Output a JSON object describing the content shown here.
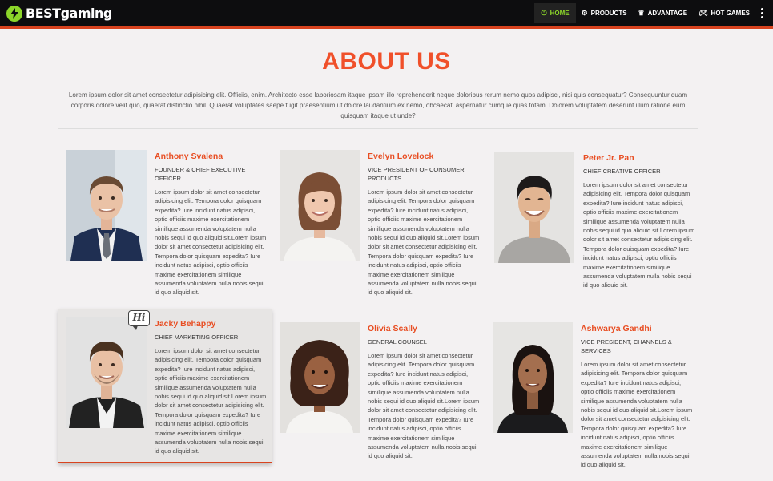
{
  "nav": {
    "brand_bold": "BEST",
    "brand_rest": "gaming",
    "items": [
      {
        "label": "HOME",
        "icon": "power-icon"
      },
      {
        "label": "PRODUCTS",
        "icon": "gear-icon"
      },
      {
        "label": "ADVANTAGE",
        "icon": "crown-icon"
      },
      {
        "label": "HOT GAMES",
        "icon": "gamepad-icon"
      }
    ],
    "accent": "#8cd62a"
  },
  "page": {
    "title": "ABOUT US",
    "intro": "Lorem ipsum dolor sit amet consectetur adipisicing elit. Officiis, enim. Architecto esse laboriosam itaque ipsam illo reprehenderit neque doloribus rerum nemo quos adipisci, nisi quis consequatur? Consequuntur quam corporis dolore velit quo, quaerat distinctio nihil. Quaerat voluptates saepe fugit praesentium ut dolore laudantium ex nemo, obcaecati aspernatur cumque quas totam. Dolorem voluptatem deserunt illum ratione eum quisquam itaque ut unde?",
    "title_color": "#f0502a"
  },
  "team": [
    {
      "name": "Anthony Svalena",
      "role": "FOUNDER & CHIEF EXECUTIVE OFFICER",
      "bio": "Lorem ipsum dolor sit amet consectetur adipisicing elit. Tempora dolor quisquam expedita? Iure incidunt natus adipisci, optio officiis maxime exercitationem similique assumenda voluptatem nulla nobis sequi id quo aliquid sit.Lorem ipsum dolor sit amet consectetur adipisicing elit. Tempora dolor quisquam expedita? Iure incidunt natus adipisci, optio officiis maxime exercitationem similique assumenda voluptatem nulla nobis sequi id quo aliquid sit."
    },
    {
      "name": "Evelyn Lovelock",
      "role": "VICE PRESIDENT OF CONSUMER PRODUCTS",
      "bio": "Lorem ipsum dolor sit amet consectetur adipisicing elit. Tempora dolor quisquam expedita? Iure incidunt natus adipisci, optio officiis maxime exercitationem similique assumenda voluptatem nulla nobis sequi id quo aliquid sit.Lorem ipsum dolor sit amet consectetur adipisicing elit. Tempora dolor quisquam expedita? Iure incidunt natus adipisci, optio officiis maxime exercitationem similique assumenda voluptatem nulla nobis sequi id quo aliquid sit."
    },
    {
      "name": "Peter Jr. Pan",
      "role": "CHIEF CREATIVE OFFICER",
      "bio": "Lorem ipsum dolor sit amet consectetur adipisicing elit. Tempora dolor quisquam expedita? Iure incidunt natus adipisci, optio officiis maxime exercitationem similique assumenda voluptatem nulla nobis sequi id quo aliquid sit.Lorem ipsum dolor sit amet consectetur adipisicing elit. Tempora dolor quisquam expedita? Iure incidunt natus adipisci, optio officiis maxime exercitationem similique assumenda voluptatem nulla nobis sequi id quo aliquid sit."
    },
    {
      "name": "Jacky Behappy",
      "role": "CHIEF MARKETING OFFICER",
      "bio": "Lorem ipsum dolor sit amet consectetur adipisicing elit. Tempora dolor quisquam expedita? Iure incidunt natus adipisci, optio officiis maxime exercitationem similique assumenda voluptatem nulla nobis sequi id quo aliquid sit.Lorem ipsum dolor sit amet consectetur adipisicing elit. Tempora dolor quisquam expedita? Iure incidunt natus adipisci, optio officiis maxime exercitationem similique assumenda voluptatem nulla nobis sequi id quo aliquid sit.",
      "badge": "Hi"
    },
    {
      "name": "Olivia Scally",
      "role": "GENERAL COUNSEL",
      "bio": "Lorem ipsum dolor sit amet consectetur adipisicing elit. Tempora dolor quisquam expedita? Iure incidunt natus adipisci, optio officiis maxime exercitationem similique assumenda voluptatem nulla nobis sequi id quo aliquid sit.Lorem ipsum dolor sit amet consectetur adipisicing elit. Tempora dolor quisquam expedita? Iure incidunt natus adipisci, optio officiis maxime exercitationem similique assumenda voluptatem nulla nobis sequi id quo aliquid sit."
    },
    {
      "name": "Ashwarya Gandhi",
      "role": "VICE PRESIDENT, CHANNELS & SERVICES",
      "bio": "Lorem ipsum dolor sit amet consectetur adipisicing elit. Tempora dolor quisquam expedita? Iure incidunt natus adipisci, optio officiis maxime exercitationem similique assumenda voluptatem nulla nobis sequi id quo aliquid sit.Lorem ipsum dolor sit amet consectetur adipisicing elit. Tempora dolor quisquam expedita? Iure incidunt natus adipisci, optio officiis maxime exercitationem similique assumenda voluptatem nulla nobis sequi id quo aliquid sit."
    }
  ]
}
